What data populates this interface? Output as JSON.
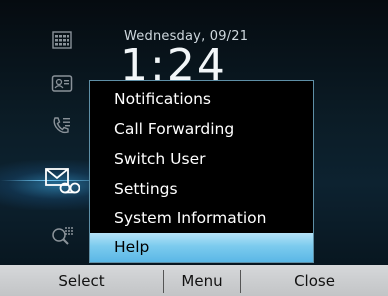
{
  "status": {
    "date": "Wednesday, 09/21",
    "time": "1:24"
  },
  "sidebar": {
    "icons": [
      "calendar-icon",
      "directory-icon",
      "call-list-icon",
      "messages-icon",
      "voicemail-search-icon"
    ],
    "highlight_color": "#4fb6ec"
  },
  "menu": {
    "items": [
      {
        "label": "Notifications"
      },
      {
        "label": "Call Forwarding"
      },
      {
        "label": "Switch User"
      },
      {
        "label": "Settings"
      },
      {
        "label": "System Information"
      },
      {
        "label": "Help"
      }
    ],
    "selected_index": 5,
    "selected_color": "#7ccbee"
  },
  "softkeys": {
    "select": "Select",
    "menu": "Menu",
    "close": "Close"
  }
}
